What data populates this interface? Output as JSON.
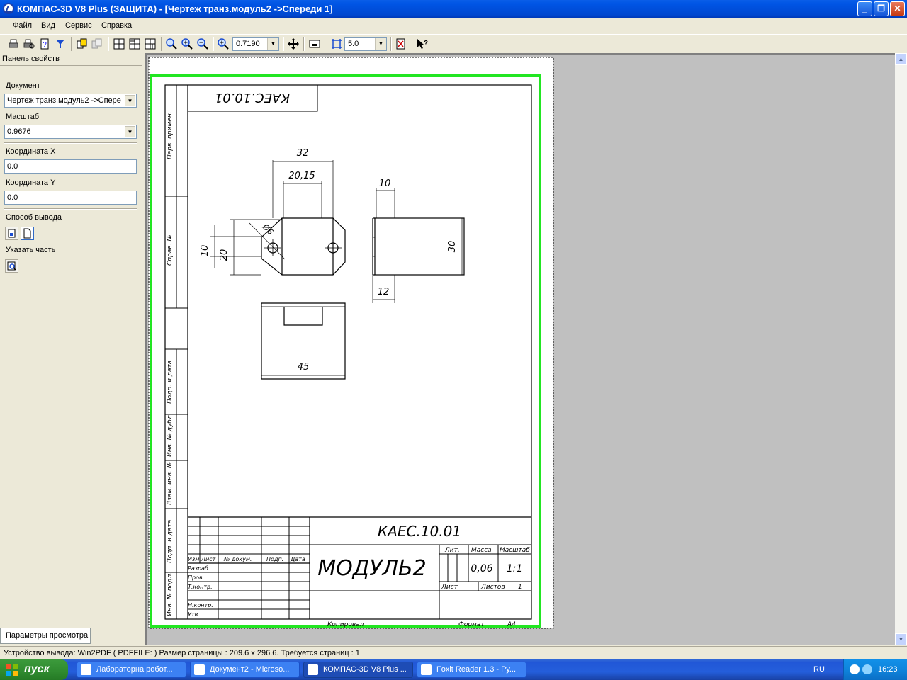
{
  "window": {
    "title": "КОМПАС-3D V8 Plus (ЗАЩИТА) - [Чертеж транз.модуль2 ->Спереди 1]",
    "minimize": "_",
    "restore": "❐",
    "close": "✕"
  },
  "menu": [
    "Файл",
    "Вид",
    "Сервис",
    "Справка"
  ],
  "toolbar": {
    "zoom_value": "0.7190",
    "step_value": "5.0"
  },
  "panel": {
    "header": "Панель свойств",
    "document_label": "Документ",
    "document_value": "Чертеж транз.модуль2 ->Спере",
    "scale_label": "Масштаб",
    "scale_value": "0.9676",
    "coord_x_label": "Координата X",
    "coord_x_value": "0.0",
    "coord_y_label": "Координата Y",
    "coord_y_value": "0.0",
    "output_label": "Способ вывода",
    "part_label": "Указать часть",
    "tab": "Параметры просмотра"
  },
  "drawing": {
    "code_top": "КАЕС.10.01",
    "code_main": "КАЕС.10.01",
    "name": "МОДУЛЬ2",
    "side_labels": [
      "Перв. примен.",
      "Справ. №",
      "Подп. и дата",
      "Инв. № дубл.",
      "Взам. инв. №",
      "Подп. и дата",
      "Инв. № подл."
    ],
    "dims": {
      "d32": "32",
      "d2015": "20,15",
      "d6": "Ø6",
      "d10a": "10",
      "d20": "20",
      "d10b": "10",
      "d30": "30",
      "d12": "12",
      "d45": "45"
    },
    "tb_header": [
      "Изм.",
      "Лист",
      "№ докум.",
      "Подп.",
      "Дата"
    ],
    "tb_rows": [
      "Разраб.",
      "Пров.",
      "Т.контр.",
      "",
      "Н.контр.",
      "Утв."
    ],
    "lit_label": "Лит.",
    "mass_label": "Масса",
    "scale_label": "Масштаб",
    "mass_value": "0,06",
    "scale_value": "1:1",
    "sheet_label": "Лист",
    "sheets_label": "Листов",
    "sheets_value": "1",
    "copied": "Копировал",
    "format": "Формат",
    "format_value": "A4"
  },
  "status": "Устройство вывода: Win2PDF ( PDFFILE: )  Размер страницы : 209.6 x 296.6.  Требуется страниц : 1",
  "taskbar": {
    "start": "пуск",
    "tasks": [
      "Лабораторна  робот...",
      "Документ2 - Microso...",
      "КОМПАС-3D V8 Plus ...",
      "Foxit Reader 1.3 - Ру..."
    ],
    "lang": "RU",
    "clock": "16:23"
  },
  "colors": {
    "frame_green": "#22e622",
    "title_blue": "#0055e5"
  }
}
